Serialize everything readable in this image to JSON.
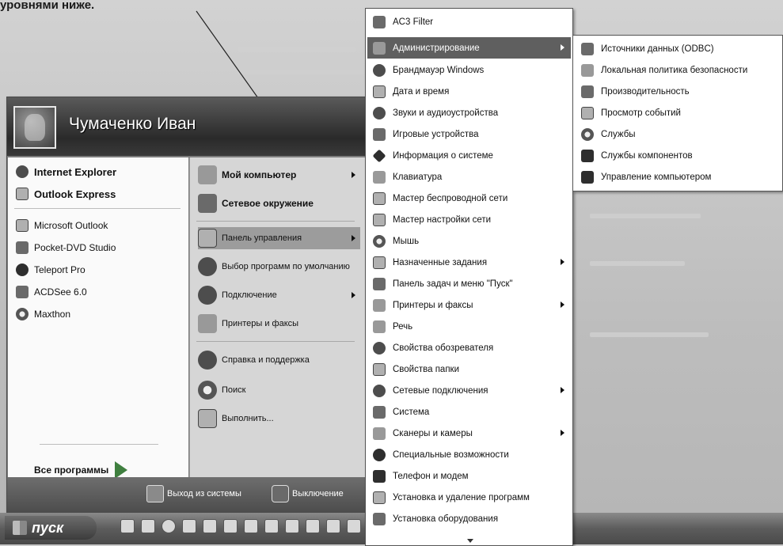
{
  "caption": "уровнями ниже.",
  "start_menu": {
    "username": "Чумаченко Иван",
    "pinned": [
      {
        "label": "Internet Explorer",
        "icon": "internet-explorer-icon"
      },
      {
        "label": "Outlook Express",
        "icon": "outlook-express-icon"
      }
    ],
    "recent": [
      {
        "label": "Microsoft Outlook",
        "icon": "outlook-icon"
      },
      {
        "label": "Pocket-DVD Studio",
        "icon": "dvd-studio-icon"
      },
      {
        "label": "Teleport Pro",
        "icon": "teleport-icon"
      },
      {
        "label": "ACDSee 6.0",
        "icon": "acdsee-icon"
      },
      {
        "label": "Maxthon",
        "icon": "maxthon-icon"
      }
    ],
    "all_programs": "Все программы",
    "right": [
      {
        "label": "Мой компьютер",
        "icon": "computer-icon"
      },
      {
        "label": "Сетевое окружение",
        "icon": "network-icon"
      },
      {
        "label": "Панель управления",
        "icon": "control-panel-icon"
      },
      {
        "label": "Выбор программ по умолчанию",
        "icon": "default-programs-icon"
      },
      {
        "label": "Подключение",
        "icon": "connect-icon"
      },
      {
        "label": "Принтеры и факсы",
        "icon": "printer-icon"
      },
      {
        "label": "Справка и поддержка",
        "icon": "help-icon"
      },
      {
        "label": "Поиск",
        "icon": "search-icon"
      },
      {
        "label": "Выполнить...",
        "icon": "run-icon"
      }
    ],
    "logoff": "Выход из системы",
    "shutdown": "Выключение"
  },
  "taskbar": {
    "start_label": "пуск"
  },
  "control_panel_menu": [
    {
      "label": "AC3 Filter",
      "icon": "ac3-filter-icon"
    },
    {
      "label": "Администрирование",
      "icon": "administration-icon"
    },
    {
      "label": "Брандмауэр Windows",
      "icon": "firewall-icon"
    },
    {
      "label": "Дата и время",
      "icon": "date-time-icon"
    },
    {
      "label": "Звуки и аудиоустройства",
      "icon": "sound-icon"
    },
    {
      "label": "Игровые устройства",
      "icon": "gamepad-icon"
    },
    {
      "label": "Информация о системе",
      "icon": "system-info-icon"
    },
    {
      "label": "Клавиатура",
      "icon": "keyboard-icon"
    },
    {
      "label": "Мастер беспроводной сети",
      "icon": "wireless-icon"
    },
    {
      "label": "Мастер настройки сети",
      "icon": "network-setup-icon"
    },
    {
      "label": "Мышь",
      "icon": "mouse-icon"
    },
    {
      "label": "Назначенные задания",
      "icon": "scheduled-tasks-icon"
    },
    {
      "label": "Панель задач и меню \"Пуск\"",
      "icon": "taskbar-icon"
    },
    {
      "label": "Принтеры и факсы",
      "icon": "printer-icon"
    },
    {
      "label": "Речь",
      "icon": "speech-icon"
    },
    {
      "label": "Свойства обозревателя",
      "icon": "browser-options-icon"
    },
    {
      "label": "Свойства папки",
      "icon": "folder-options-icon"
    },
    {
      "label": "Сетевые подключения",
      "icon": "network-connections-icon"
    },
    {
      "label": "Система",
      "icon": "system-icon"
    },
    {
      "label": "Сканеры и камеры",
      "icon": "scanner-icon"
    },
    {
      "label": "Специальные возможности",
      "icon": "accessibility-icon"
    },
    {
      "label": "Телефон и модем",
      "icon": "phone-modem-icon"
    },
    {
      "label": "Установка и удаление программ",
      "icon": "add-remove-icon"
    },
    {
      "label": "Установка оборудования",
      "icon": "hardware-icon"
    }
  ],
  "admin_menu": [
    {
      "label": "Источники данных (ODBC)",
      "icon": "odbc-icon"
    },
    {
      "label": "Локальная политика безопасности",
      "icon": "security-policy-icon"
    },
    {
      "label": "Производительность",
      "icon": "performance-icon"
    },
    {
      "label": "Просмотр событий",
      "icon": "event-viewer-icon"
    },
    {
      "label": "Службы",
      "icon": "services-icon"
    },
    {
      "label": "Службы компонентов",
      "icon": "component-services-icon"
    },
    {
      "label": "Управление компьютером",
      "icon": "computer-management-icon"
    }
  ]
}
